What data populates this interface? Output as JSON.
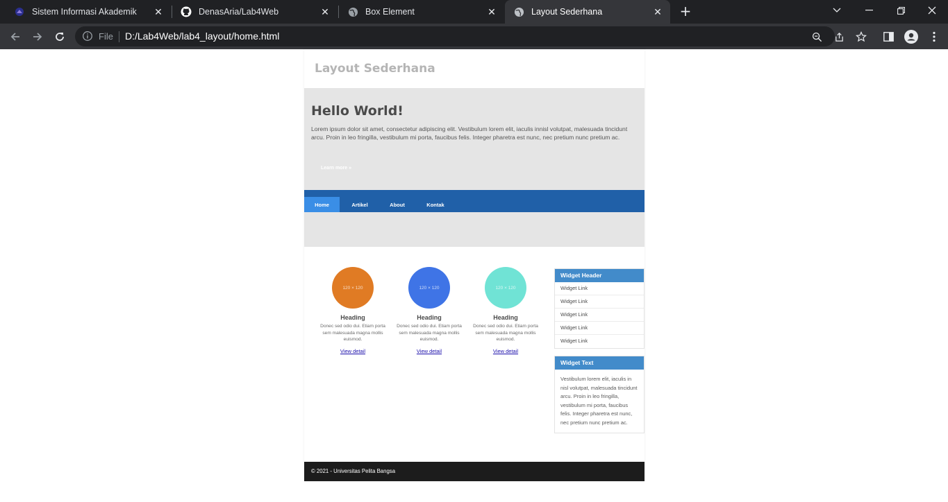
{
  "browser": {
    "tabs": [
      {
        "title": "Sistem Informasi Akademik",
        "icon": "academic-icon",
        "active": false
      },
      {
        "title": "DenasAria/Lab4Web",
        "icon": "github-icon",
        "active": false
      },
      {
        "title": "Box Element",
        "icon": "globe-icon",
        "active": false
      },
      {
        "title": "Layout Sederhana",
        "icon": "globe-icon",
        "active": true
      }
    ],
    "address": {
      "scheme_label": "File",
      "url": "D:/Lab4Web/lab4_layout/home.html"
    }
  },
  "page": {
    "header": {
      "title": "Layout Sederhana"
    },
    "hero": {
      "title": "Hello World!",
      "text": "Lorem ipsum dolor sit amet, consectetur adipiscing elit. Vestibulum lorem elit, iaculis innisl volutpat, malesuada tincidunt arcu. Proin in leo fringilla, vestibulum mi porta, faucibus felis. Integer pharetra est nunc, nec pretium nunc pretium ac.",
      "button": "Learn more »"
    },
    "nav": [
      {
        "label": "Home",
        "active": true
      },
      {
        "label": "Artikel",
        "active": false
      },
      {
        "label": "About",
        "active": false
      },
      {
        "label": "Kontak",
        "active": false
      }
    ],
    "cards": [
      {
        "image_label": "120 × 120",
        "color": "#e07b24",
        "heading": "Heading",
        "text": "Donec sed odio dui. Etiam porta sem malesuada magna mollis euismod.",
        "link": "View detail"
      },
      {
        "image_label": "120 × 120",
        "color": "#3f74e6",
        "heading": "Heading",
        "text": "Donec sed odio dui. Etiam porta sem malesuada magna mollis euismod.",
        "link": "View detail"
      },
      {
        "image_label": "120 × 120",
        "color": "#70e3d5",
        "heading": "Heading",
        "text": "Donec sed odio dui. Etiam porta sem malesuada magna mollis euismod.",
        "link": "View detail"
      }
    ],
    "widget_links": {
      "header": "Widget Header",
      "links": [
        "Widget Link",
        "Widget Link",
        "Widget Link",
        "Widget Link",
        "Widget Link"
      ]
    },
    "widget_text": {
      "header": "Widget Text",
      "text": "Vestibulum lorem elit, iaculis in nisl volutpat, malesuada tincidunt arcu. Proin in leo fringilla, vestibulum mi porta, faucibus felis. Integer pharetra est nunc, nec pretium nunc pretium ac."
    },
    "footer": {
      "text": "© 2021 - Universitas Pelita Bangsa"
    }
  }
}
